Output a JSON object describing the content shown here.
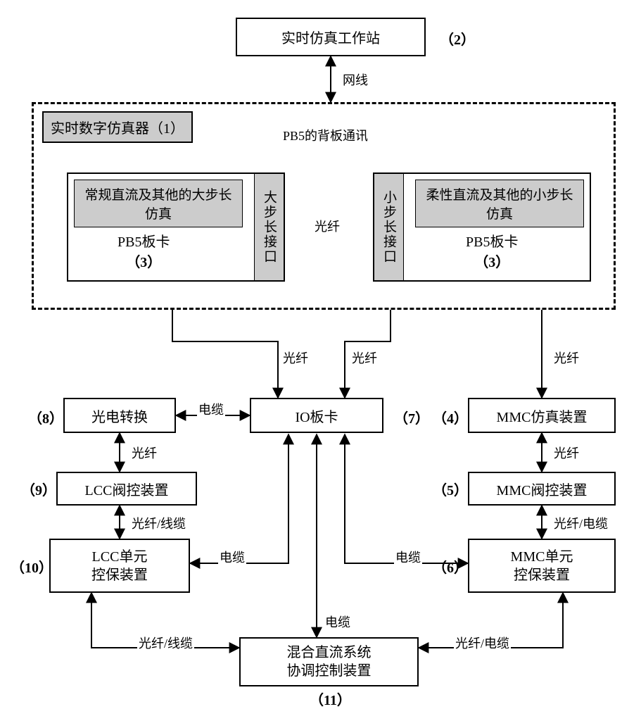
{
  "top": {
    "label": "实时仿真工作站",
    "ref": "（2）",
    "link": "网线"
  },
  "simulator": {
    "title": "实时数字仿真器（1）",
    "backplane": "PB5的背板通讯",
    "left_card": {
      "gray": "常规直流及其他的大步长仿真",
      "name": "PB5板卡",
      "ref": "（3）",
      "port": "大步长接口"
    },
    "fiber": "光纤",
    "right_card": {
      "gray": "柔性直流及其他的小步长仿真",
      "name": "PB5板卡",
      "ref": "（3）",
      "port": "小步长接口"
    }
  },
  "io": {
    "name": "IO板卡",
    "ref": "（7）"
  },
  "mmc_sim": {
    "name": "MMC仿真装置",
    "ref": "（4）"
  },
  "mmc_valve": {
    "name": "MMC阀控装置",
    "ref": "（5）"
  },
  "mmc_unit": {
    "name": "MMC单元控保装置",
    "ref": "（6）"
  },
  "opto": {
    "name": "光电转换",
    "ref": "（8）"
  },
  "lcc_valve": {
    "name": "LCC阀控装置",
    "ref": "（9）"
  },
  "lcc_unit": {
    "name": "LCC单元控保装置",
    "ref": "（10）"
  },
  "coord": {
    "name": "混合直流系统协调控制装置",
    "ref": "（11）"
  },
  "labels": {
    "fiber": "光纤",
    "cable": "电缆",
    "fiber_line": "光纤/线缆",
    "fiber_cable": "光纤/电缆"
  }
}
